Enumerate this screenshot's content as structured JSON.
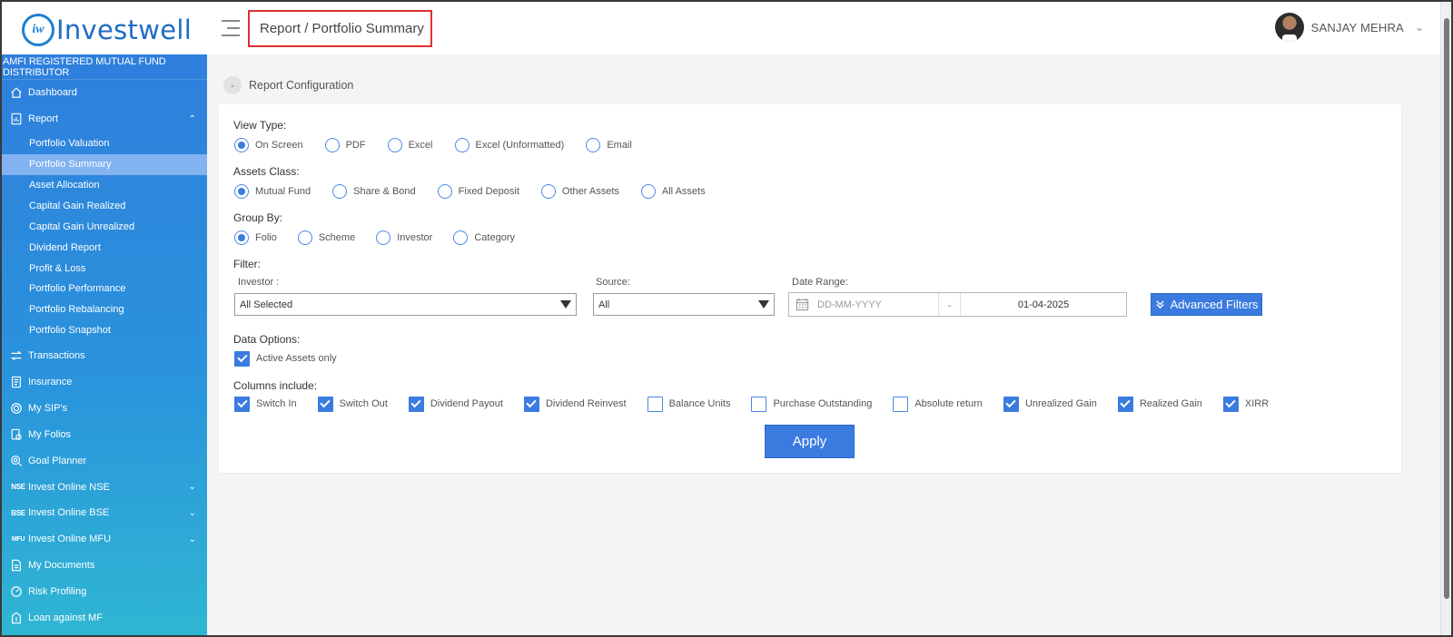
{
  "header": {
    "brand": "Investwell",
    "brand_mark": "iw",
    "breadcrumb": "Report / Portfolio Summary",
    "user_name": "SANJAY MEHRA"
  },
  "sidebar": {
    "tagline": "AMFI REGISTERED MUTUAL FUND DISTRIBUTOR",
    "items": [
      {
        "label": "Dashboard",
        "icon": "home-icon"
      },
      {
        "label": "Report",
        "icon": "report-icon",
        "expanded": true
      },
      {
        "label": "Transactions",
        "icon": "transfer-icon"
      },
      {
        "label": "Insurance",
        "icon": "document-icon"
      },
      {
        "label": "My SIP's",
        "icon": "target-icon"
      },
      {
        "label": "My Folios",
        "icon": "folio-icon"
      },
      {
        "label": "Goal Planner",
        "icon": "goal-icon"
      },
      {
        "label": "Invest Online NSE",
        "icon_text": "NSE"
      },
      {
        "label": "Invest Online BSE",
        "icon_text": "BSE"
      },
      {
        "label": "Invest Online MFU",
        "icon_text": "MFU"
      },
      {
        "label": "My Documents",
        "icon": "document-icon"
      },
      {
        "label": "Risk Profiling",
        "icon": "gauge-icon"
      },
      {
        "label": "Loan against MF",
        "icon": "loan-icon"
      }
    ],
    "report_sub": [
      "Portfolio Valuation",
      "Portfolio Summary",
      "Asset Allocation",
      "Capital Gain Realized",
      "Capital Gain Unrealized",
      "Dividend Report",
      "Profit & Loss",
      "Portfolio Performance",
      "Portfolio Rebalancing",
      "Portfolio Snapshot"
    ],
    "active_sub": "Portfolio Summary"
  },
  "config": {
    "title": "Report Configuration",
    "collapse_symbol": "-",
    "view_type": {
      "label": "View Type:",
      "options": [
        "On Screen",
        "PDF",
        "Excel",
        "Excel (Unformatted)",
        "Email"
      ],
      "selected": "On Screen"
    },
    "assets_class": {
      "label": "Assets Class:",
      "options": [
        "Mutual Fund",
        "Share & Bond",
        "Fixed Deposit",
        "Other Assets",
        "All Assets"
      ],
      "selected": "Mutual Fund"
    },
    "group_by": {
      "label": "Group By:",
      "options": [
        "Folio",
        "Scheme",
        "Investor",
        "Category"
      ],
      "selected": "Folio"
    },
    "filter": {
      "label": "Filter:",
      "investor_label": "Investor :",
      "investor_value": "All Selected",
      "source_label": "Source:",
      "source_value": "All",
      "date_range_label": "Date Range:",
      "date_from_placeholder": "DD-MM-YYYY",
      "date_separator": "-",
      "date_to": "01-04-2025",
      "advanced_filters": "Advanced Filters"
    },
    "data_options": {
      "label": "Data Options:",
      "active_assets": "Active Assets only",
      "active_assets_checked": true
    },
    "columns": {
      "label": "Columns include:",
      "items": [
        {
          "label": "Switch In",
          "checked": true
        },
        {
          "label": "Switch Out",
          "checked": true
        },
        {
          "label": "Dividend Payout",
          "checked": true
        },
        {
          "label": "Dividend Reinvest",
          "checked": true
        },
        {
          "label": "Balance Units",
          "checked": false
        },
        {
          "label": "Purchase Outstanding",
          "checked": false
        },
        {
          "label": "Absolute return",
          "checked": false
        },
        {
          "label": "Unrealized Gain",
          "checked": true
        },
        {
          "label": "Realized Gain",
          "checked": true
        },
        {
          "label": "XIRR",
          "checked": true
        }
      ]
    },
    "apply": "Apply"
  },
  "colors": {
    "accent": "#3b7be0",
    "breadcrumb_border": "#e03030",
    "sidebar_top": "#2f7fdc",
    "sidebar_bottom": "#2fb6d3"
  }
}
